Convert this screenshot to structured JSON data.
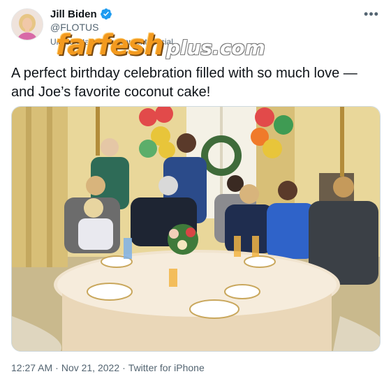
{
  "author": {
    "display_name": "Jill Biden",
    "handle": "@FLOTUS",
    "subtitle": "United States government official",
    "avatar_icon": "user-avatar",
    "verified_icon": "verified-badge-icon",
    "verified_color": "#1d9bf0"
  },
  "watermark": {
    "brand": "farfesh",
    "suffix": "plus.com"
  },
  "tweet": {
    "text": "A perfect birthday celebration filled with so much love — and Joe’s favorite coconut cake!",
    "more_icon": "more-options-icon"
  },
  "media": {
    "alt": "Family gathered around a round table for a birthday celebration"
  },
  "meta": {
    "time": "12:27 AM",
    "sep1": "·",
    "date": "Nov 21, 2022",
    "sep2": "·",
    "source": "Twitter for iPhone"
  },
  "colors": {
    "text": "#0f1419",
    "secondary": "#536471",
    "border": "#cfd9de",
    "watermark_orange": "#f39a1f"
  }
}
